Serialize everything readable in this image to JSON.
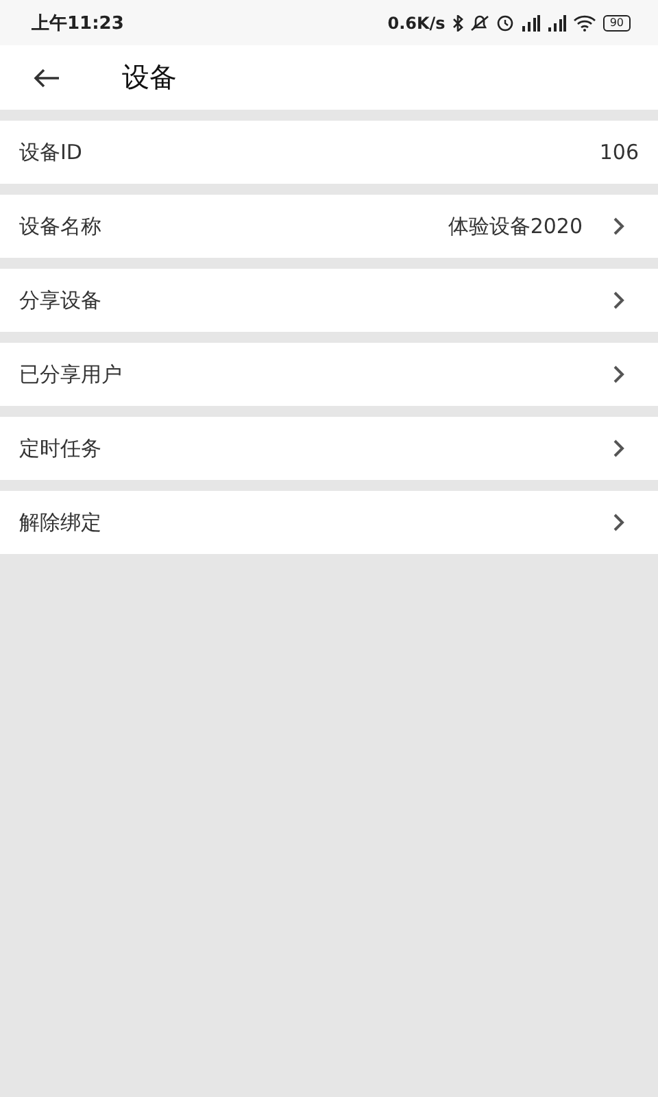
{
  "status_bar": {
    "time": "上午11:23",
    "speed": "0.6K/s",
    "battery": "90"
  },
  "toolbar": {
    "title": "设备"
  },
  "rows": [
    {
      "kind": "info",
      "label": "设备ID",
      "value": "106"
    },
    {
      "kind": "link",
      "label": "设备名称",
      "value": "体验设备2020"
    },
    {
      "kind": "link",
      "label": "分享设备"
    },
    {
      "kind": "link",
      "label": "已分享用户"
    },
    {
      "kind": "link",
      "label": "定时任务"
    },
    {
      "kind": "link",
      "label": "解除绑定"
    }
  ]
}
